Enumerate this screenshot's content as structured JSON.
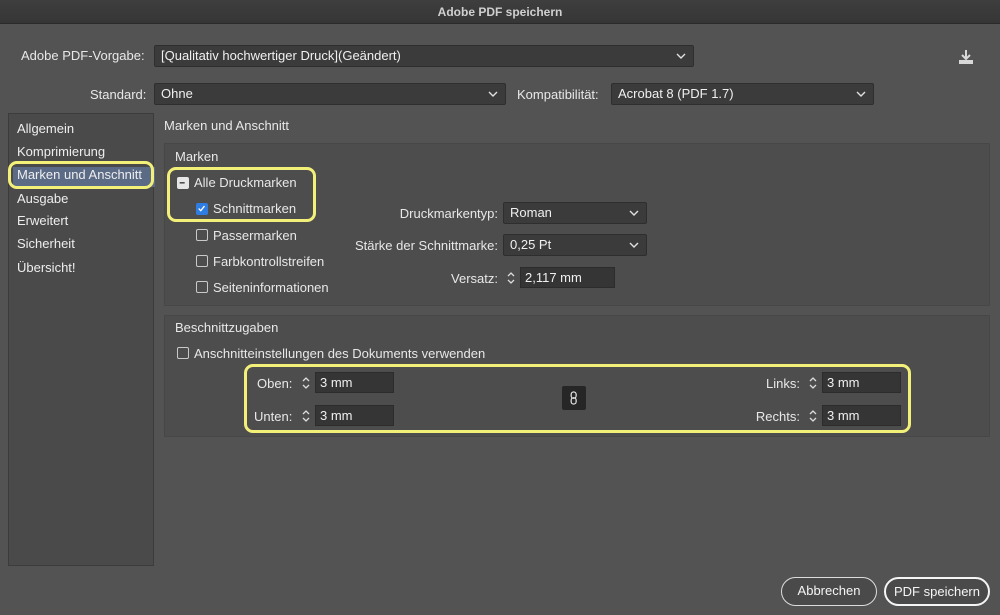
{
  "window": {
    "title": "Adobe PDF speichern"
  },
  "preset": {
    "label": "Adobe PDF-Vorgabe:",
    "value": "[Qualitativ hochwertiger Druck](Geändert)"
  },
  "standard": {
    "label": "Standard:",
    "value": "Ohne"
  },
  "compat": {
    "label": "Kompatibilität:",
    "value": "Acrobat 8 (PDF 1.7)"
  },
  "sidebar": {
    "items": [
      {
        "label": "Allgemein"
      },
      {
        "label": "Komprimierung"
      },
      {
        "label": "Marken und Anschnitt"
      },
      {
        "label": "Ausgabe"
      },
      {
        "label": "Erweitert"
      },
      {
        "label": "Sicherheit"
      },
      {
        "label": "Übersicht!"
      }
    ],
    "selected": "Marken und Anschnitt"
  },
  "section_title": "Marken und Anschnitt",
  "marks": {
    "heading": "Marken",
    "all": {
      "label": "Alle Druckmarken",
      "state": "mixed"
    },
    "checks": [
      {
        "label": "Schnittmarken",
        "checked": true
      },
      {
        "label": "Passermarken",
        "checked": false
      },
      {
        "label": "Farbkontrollstreifen",
        "checked": false
      },
      {
        "label": "Seiteninformationen",
        "checked": false
      }
    ],
    "type": {
      "label": "Druckmarkentyp:",
      "value": "Roman"
    },
    "weight": {
      "label": "Stärke der Schnittmarke:",
      "value": "0,25 Pt"
    },
    "offset": {
      "label": "Versatz:",
      "value": "2,117 mm"
    }
  },
  "bleed": {
    "heading": "Beschnittzugaben",
    "use_doc": {
      "label": "Anschnitteinstellungen des Dokuments verwenden",
      "checked": false
    },
    "top": {
      "label": "Oben:",
      "value": "3 mm"
    },
    "bottom": {
      "label": "Unten:",
      "value": "3 mm"
    },
    "left": {
      "label": "Links:",
      "value": "3 mm"
    },
    "right": {
      "label": "Rechts:",
      "value": "3 mm"
    },
    "link_icon": "chain-link-icon"
  },
  "buttons": {
    "cancel": "Abbrechen",
    "save": "PDF speichern"
  },
  "colors": {
    "highlight": "#f3f07a",
    "selection": "#5b6b86",
    "checkbox": "#2f7de1"
  }
}
